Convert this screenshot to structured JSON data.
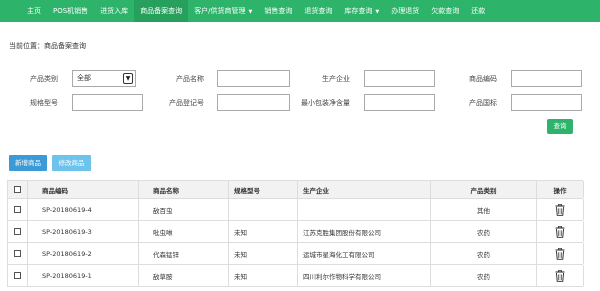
{
  "nav": {
    "items": [
      {
        "label": "主页"
      },
      {
        "label": "POS机销售"
      },
      {
        "label": "进货入库"
      },
      {
        "label": "商品备案查询",
        "active": true
      },
      {
        "label": "客户/供货商管理",
        "dropdown": true
      },
      {
        "label": "销售查询"
      },
      {
        "label": "退货查询"
      },
      {
        "label": "库存查询",
        "dropdown": true
      },
      {
        "label": "办理退货"
      },
      {
        "label": "欠款查询"
      },
      {
        "label": "还款"
      }
    ]
  },
  "breadcrumb": "当前位置：商品备案查询",
  "filters": {
    "category_label": "产品类别",
    "category_value": "全部",
    "name_label": "产品名称",
    "company_label": "生产企业",
    "code_label": "商品编码",
    "spec_label": "规格型号",
    "reg_label": "产品登记号",
    "pack_label": "最小包装净含量",
    "origin_label": "产品国标"
  },
  "buttons": {
    "query": "查询",
    "add": "新增商品",
    "edit": "修改商品"
  },
  "table": {
    "headers": {
      "code": "商品编码",
      "name": "商品名称",
      "spec": "规格型号",
      "company": "生产企业",
      "category": "产品类别",
      "action": "操作"
    },
    "rows": [
      {
        "code": "SP-20180619-4",
        "name": "敌百虫",
        "spec": "",
        "company": "",
        "category": "其他"
      },
      {
        "code": "SP-20180619-3",
        "name": "吡虫啉",
        "spec": "未知",
        "company": "江苏克胜集团股份有限公司",
        "category": "农药"
      },
      {
        "code": "SP-20180619-2",
        "name": "代森锰锌",
        "spec": "未知",
        "company": "运城市星海化工有限公司",
        "category": "农药"
      },
      {
        "code": "SP-20180619-1",
        "name": "敌草胺",
        "spec": "未知",
        "company": "四川利尔作物科学有限公司",
        "category": "农药"
      }
    ]
  },
  "colors": {
    "nav_bg": "#2eb36a",
    "button_blue": "#3c9bd6"
  }
}
